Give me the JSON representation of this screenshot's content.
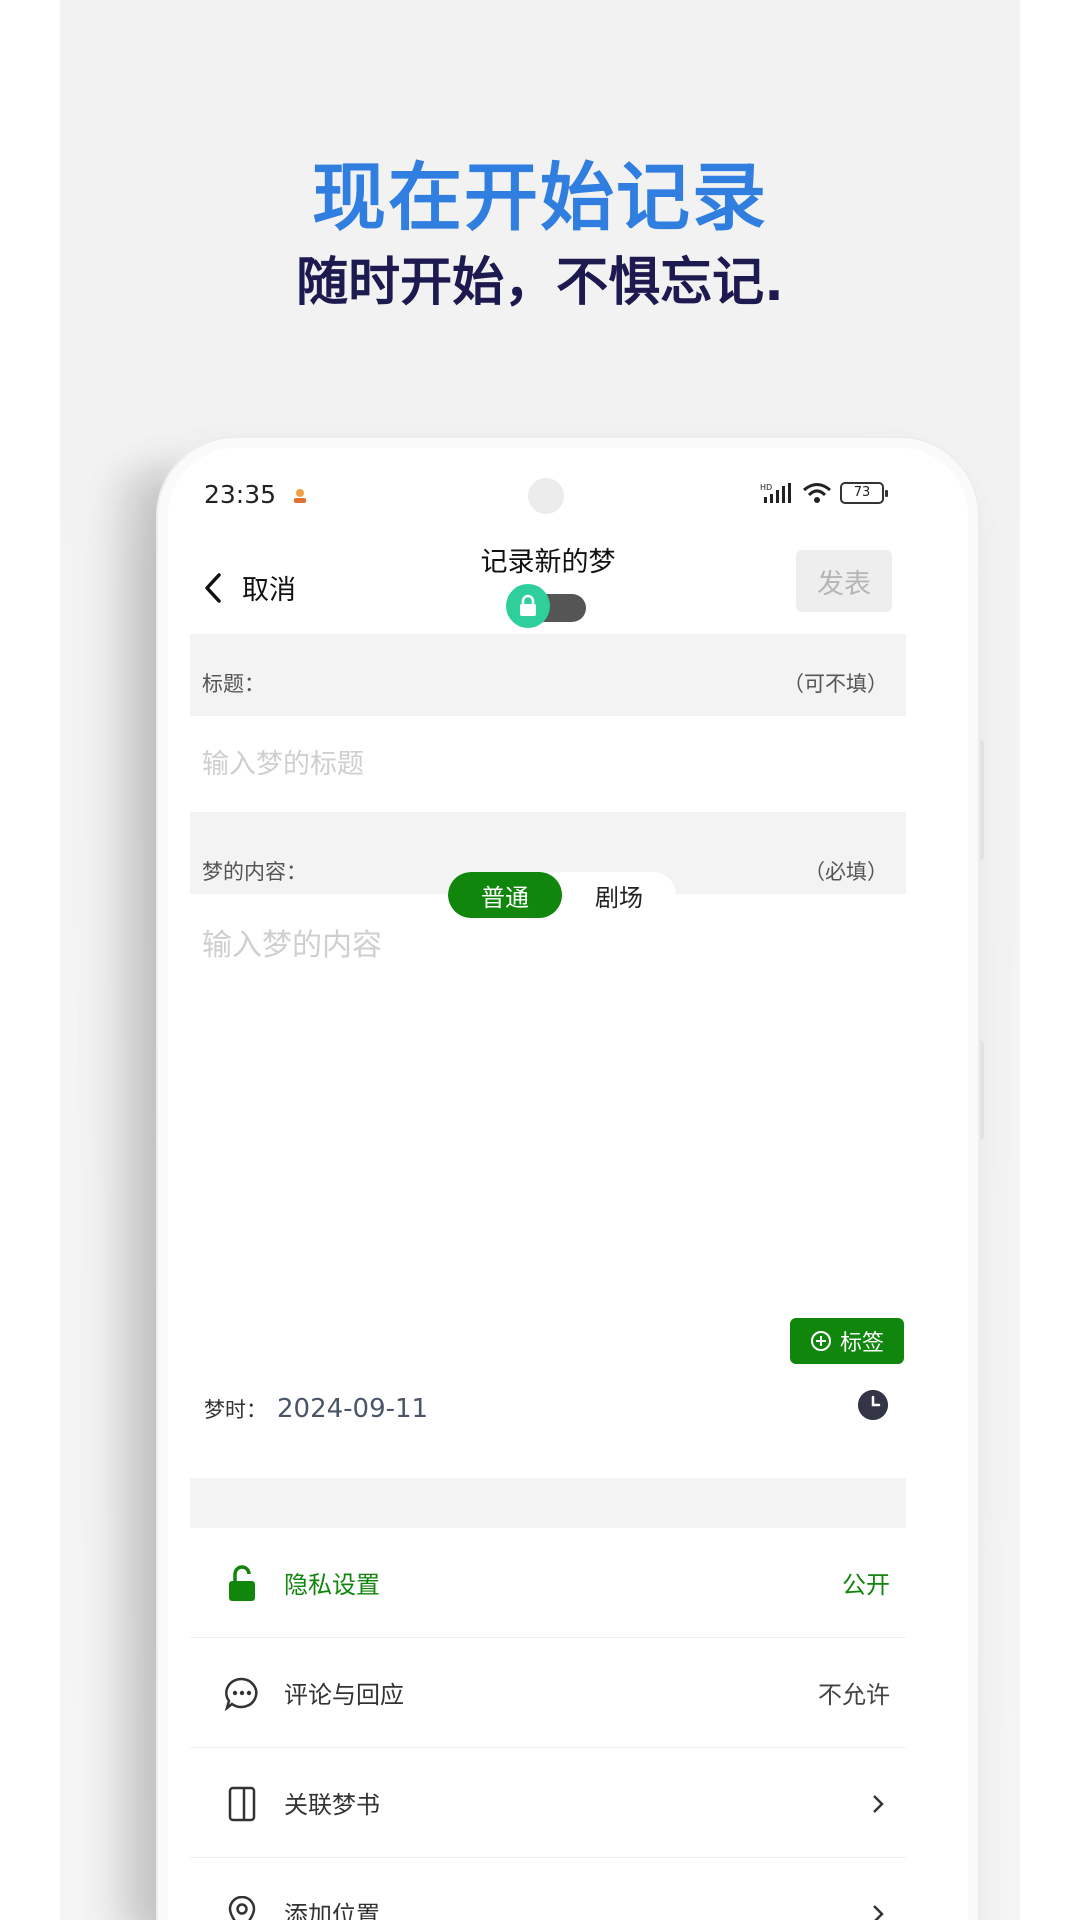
{
  "poster": {
    "headline": "现在开始记录",
    "subhead": "随时开始，不惧忘记."
  },
  "status_bar": {
    "time": "23:35",
    "battery": "73"
  },
  "nav": {
    "back_label": "取消",
    "title": "记录新的梦",
    "publish_label": "发表"
  },
  "title_section": {
    "label": "标题：",
    "note": "（可不填）",
    "placeholder": "输入梦的标题"
  },
  "content_section": {
    "label": "梦的内容：",
    "note": "（必填）",
    "placeholder": "输入梦的内容",
    "modes": [
      "普通",
      "剧场"
    ],
    "active_mode": "普通"
  },
  "tag_button": "标签",
  "dream_time": {
    "label": "梦时：",
    "value": "2024-09-11"
  },
  "settings": [
    {
      "label": "隐私设置",
      "value": "公开",
      "icon": "lock-open-icon"
    },
    {
      "label": "评论与回应",
      "value": "不允许",
      "icon": "chat-bubble-icon"
    },
    {
      "label": "关联梦书",
      "value": "",
      "icon": "book-icon"
    },
    {
      "label": "添加位置",
      "value": "",
      "icon": "location-pin-icon"
    }
  ],
  "colors": {
    "accent_green": "#10860d",
    "headline_blue": "#2f7ee0",
    "subhead_navy": "#1d1a4f",
    "lock_toggle_green": "#2fcf9c"
  }
}
